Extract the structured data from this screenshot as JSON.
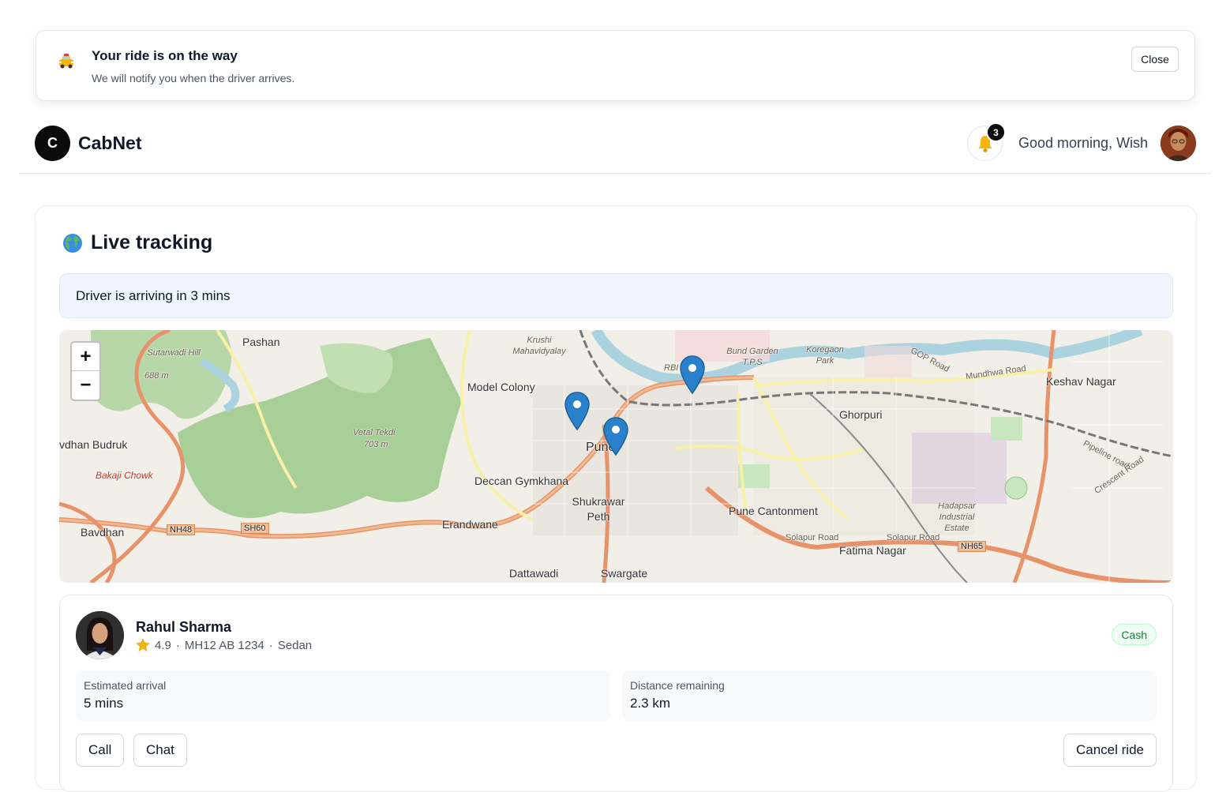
{
  "toast": {
    "title": "Your ride is on the way",
    "message": "We will notify you when the driver arrives.",
    "close_label": "Close",
    "icon": "taxi-icon"
  },
  "header": {
    "logo_letter": "C",
    "brand": "CabNet",
    "notification_count": "3",
    "greeting": "Good morning, Wish"
  },
  "tracking": {
    "title": "Live tracking",
    "title_icon": "globe-icon",
    "arrival_banner": "Driver is arriving in 3 mins",
    "map": {
      "zoom_in": "+",
      "zoom_out": "−",
      "labels": {
        "pashan": "Pashan",
        "sutarwadi": "Sutarwadi Hill",
        "sutarwadi_elev": "688 m",
        "krushi": "Krushi Mahavidyalay",
        "model_colony": "Model Colony",
        "bund_garden": "Bund Garden T.P.S",
        "koregaon": "Koregaon Park",
        "rbi": "RBI Road",
        "keshav_nagar": "Keshav Nagar",
        "ghorpuri": "Ghorpuri",
        "vetal_tekdi": "Vetal Tekdi",
        "vetal_elev": "703 m",
        "vadhan_budruk": "vdhan Budruk",
        "bakaji": "Bakaji Chowk",
        "pune": "Pune",
        "deccan": "Deccan Gymkhana",
        "shukrawar": "Shukrawar Peth",
        "pune_cantonment": "Pune Cantonment",
        "hadapsar": "Hadapsar Industrial Estate",
        "bavdhan": "Bavdhan",
        "nh48": "NH48",
        "sh60": "SH60",
        "erandwane": "Erandwane",
        "fatima_nagar": "Fatima Nagar",
        "nh65": "NH65",
        "dattawadi": "Dattawadi",
        "swargate": "Swargate",
        "solapur_road": "Solapur Road",
        "mundhwa_road": "Mundhwa Road",
        "gop_road": "GOP Road",
        "pipeline_road": "Pipeline road",
        "crescent_road": "Crescent Road"
      }
    }
  },
  "driver": {
    "name": "Rahul Sharma",
    "rating": "4.9",
    "plate": "MH12 AB 1234",
    "car_type": "Sedan",
    "separator": "·",
    "payment": "Cash",
    "eta_label": "Estimated arrival",
    "eta_value": "5 mins",
    "distance_label": "Distance remaining",
    "distance_value": "2.3 km",
    "call_label": "Call",
    "chat_label": "Chat",
    "cancel_label": "Cancel ride"
  },
  "colors": {
    "primary_dark": "#0b0b0b",
    "banner_bg": "#eff6ff",
    "cash_green": "#15803d",
    "pin_blue": "#2a81cb"
  }
}
